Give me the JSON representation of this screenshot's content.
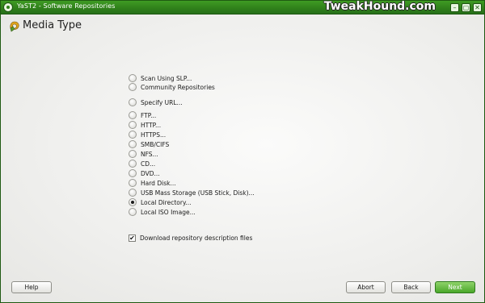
{
  "window": {
    "title": "YaST2 - Software Repositories",
    "watermark": "TweakHound.com"
  },
  "page": {
    "title": "Media Type"
  },
  "options": [
    {
      "label": "Scan Using SLP...",
      "checked": false
    },
    {
      "label": "Community Repositories",
      "checked": false
    },
    {
      "label": "Specify URL...",
      "checked": false
    },
    {
      "label": "FTP...",
      "checked": false
    },
    {
      "label": "HTTP...",
      "checked": false
    },
    {
      "label": "HTTPS...",
      "checked": false
    },
    {
      "label": "SMB/CIFS",
      "checked": false
    },
    {
      "label": "NFS...",
      "checked": false
    },
    {
      "label": "CD...",
      "checked": false
    },
    {
      "label": "DVD...",
      "checked": false
    },
    {
      "label": "Hard Disk...",
      "checked": false
    },
    {
      "label": "USB Mass Storage (USB Stick, Disk)...",
      "checked": false
    },
    {
      "label": "Local Directory...",
      "checked": true
    },
    {
      "label": "Local ISO Image...",
      "checked": false
    }
  ],
  "download_checkbox": {
    "label": "Download repository description files",
    "checked": true
  },
  "buttons": {
    "help": "Help",
    "abort": "Abort",
    "back": "Back",
    "next": "Next"
  },
  "colors": {
    "titlebar": "#2f7f1a",
    "next_button": "#4aa72a"
  }
}
